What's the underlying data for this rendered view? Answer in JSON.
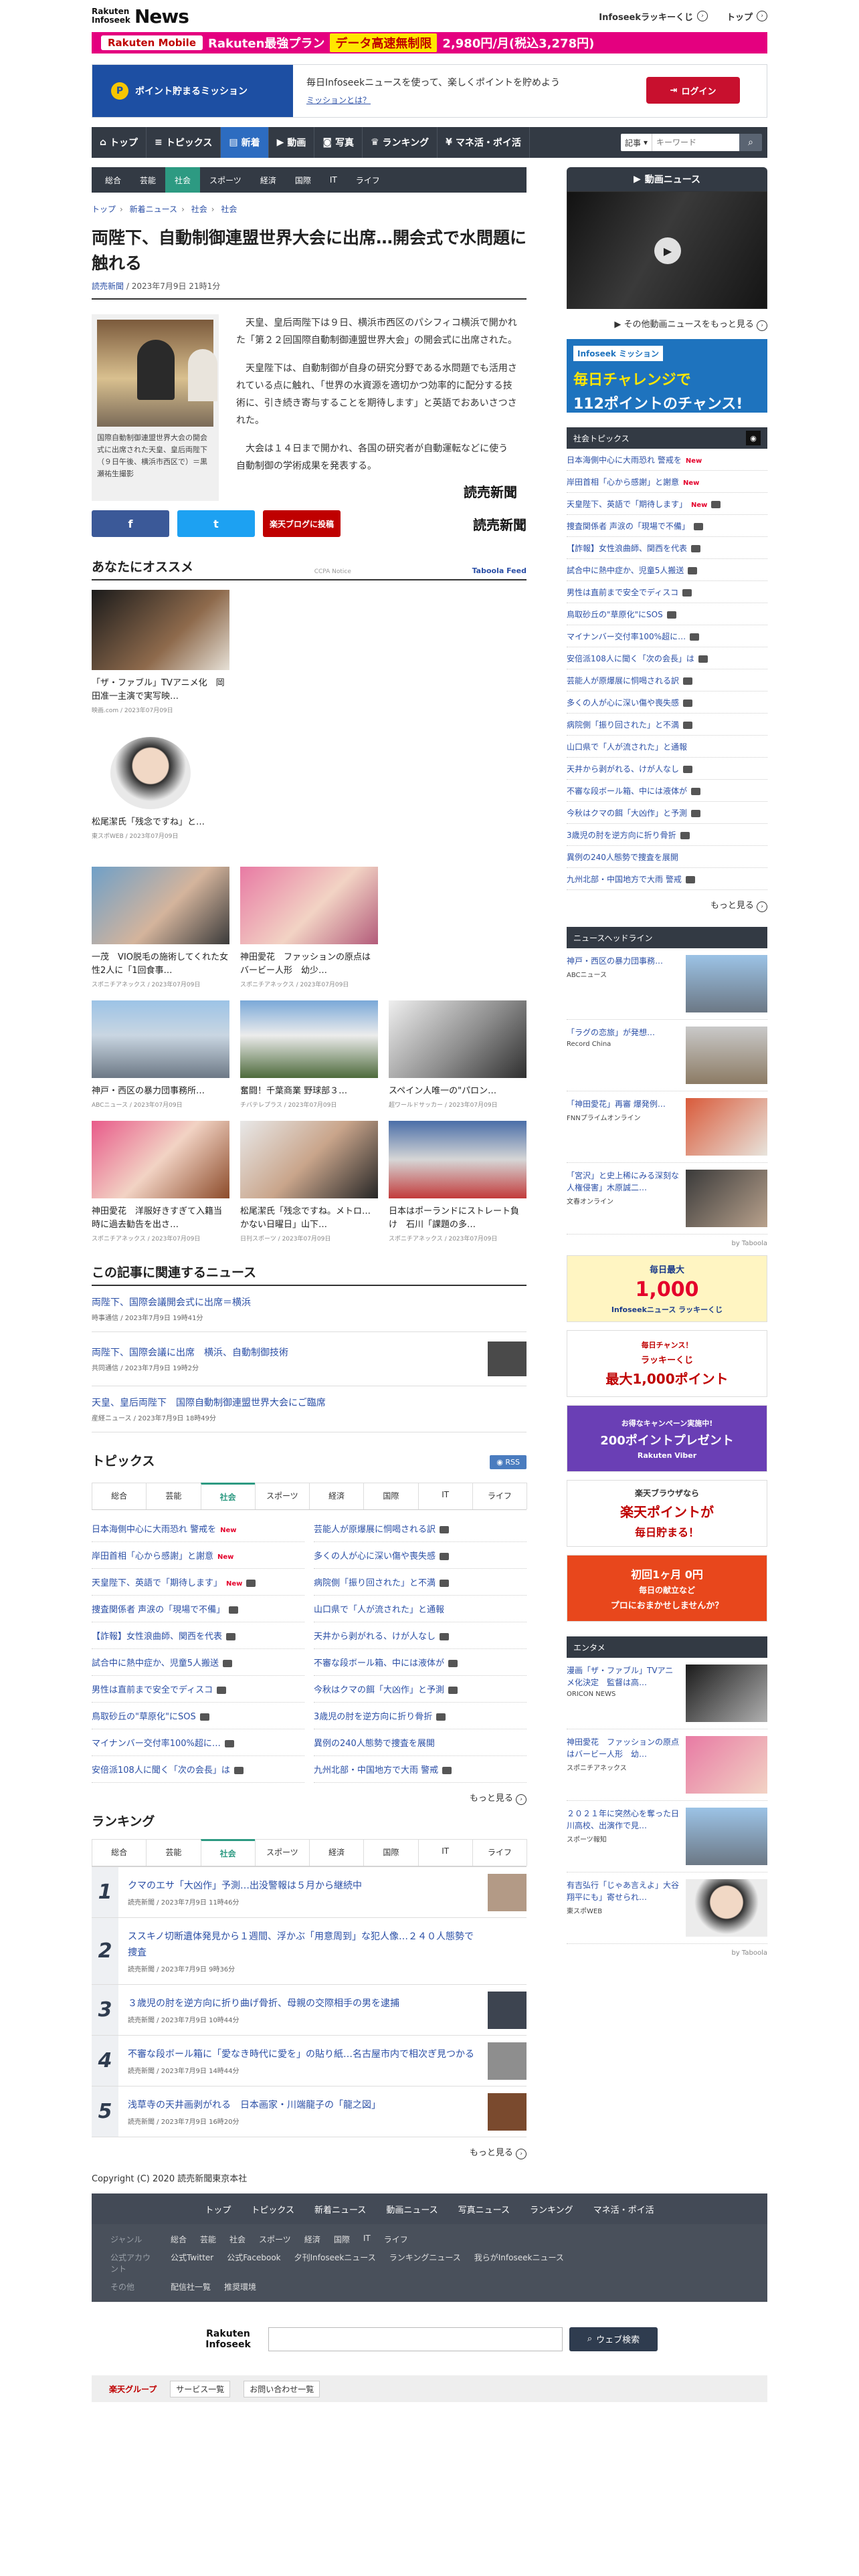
{
  "header": {
    "logo_top": "Rakuten Infoseek",
    "logo_main": "News",
    "links": [
      "Infoseekラッキーくじ",
      "トップ"
    ],
    "banner": {
      "brand": "Rakuten Mobile",
      "tagline": "Rakuten最強プラン",
      "offer": "データ高速無制限",
      "price": "2,980円/月(税込3,278円)"
    }
  },
  "mission": {
    "label": "ポイント貯まるミッション",
    "text": "毎日Infoseekニュースを使って、楽しくポイントを貯めよう",
    "link": "ミッションとは？",
    "login": "ログイン"
  },
  "gnav": {
    "items": [
      "トップ",
      "トピックス",
      "新着",
      "動画",
      "写真",
      "ランキング",
      "マネ活・ポイ活"
    ],
    "search_select": "記事",
    "search_placeholder": "キーワード"
  },
  "subnav": [
    "総合",
    "芸能",
    "社会",
    "スポーツ",
    "経済",
    "国際",
    "IT",
    "ライフ"
  ],
  "breadcrumb": [
    "トップ",
    "新着ニュース",
    "社会",
    "社会"
  ],
  "article": {
    "title": "両陛下、自動制御連盟世界大会に出席…開会式で水問題に触れる",
    "source": "読売新聞",
    "date": "2023年7月9日 21時1分",
    "caption": "国際自動制御連盟世界大会の開会式に出席された天皇、皇后両陛下（９日午後、横浜市西区で）＝黒瀬祐生撮影",
    "paragraphs": [
      "天皇、皇后両陛下は９日、横浜市西区のパシフィコ横浜で開かれた「第２２回国際自動制御連盟世界大会」の開会式に出席された。",
      "天皇陛下は、自動制御が自身の研究分野である水問題でも活用されている点に触れ、「世界の水資源を適切かつ効率的に配分する技術に、引き続き寄与することを期待します」と英語でおあいさつされた。",
      "大会は１４日まで開かれ、各国の研究者が自動運転などに使う自動制御の学術成果を発表する。"
    ],
    "publisher": "読売新聞",
    "share": [
      "f",
      "t",
      "楽天ブログに投稿"
    ]
  },
  "recommend": {
    "title": "あなたにオススメ",
    "tag": "CCPA Notice",
    "feed": "Taboola Feed",
    "items": [
      {
        "title": "「ザ・ファブル」TVアニメ化　岡田准一主演で実写映…",
        "meta": "映画.com / 2023年07月09日"
      },
      {
        "title": "松尾潔氏「残念ですね」と…",
        "meta": "東スポWEB / 2023年07月09日"
      },
      {
        "title": "一茂　VIO脱毛の施術してくれた女性2人に「1回食事…",
        "meta": "スポニチアネックス / 2023年07月09日"
      },
      {
        "title": "神田愛花　ファッションの原点はバービー人形　幼少…",
        "meta": "スポニチアネックス / 2023年07月09日"
      },
      {
        "title": "神戸・西区の暴力団事務所…",
        "meta": "ABCニュース / 2023年07月09日"
      },
      {
        "title": "奮闘！千葉商業 野球部３…",
        "meta": "チバテレプラス / 2023年07月09日"
      },
      {
        "title": "スペイン人唯一の\"パロン…",
        "meta": "超ワールドサッカー / 2023年07月09日"
      },
      {
        "title": "神田愛花　洋服好きすぎて入籍当時に過去勧告を出さ…",
        "meta": "スポニチアネックス / 2023年07月09日"
      },
      {
        "title": "松尾潔氏「残念ですね。メトロ…かない日曜日」山下…",
        "meta": "日刊スポーツ / 2023年07月09日"
      },
      {
        "title": "日本はポーランドにストレート負け　石川「課題の多…",
        "meta": "スポニチアネックス / 2023年07月09日"
      }
    ]
  },
  "related": {
    "title": "この記事に関連するニュース",
    "items": [
      {
        "title": "両陛下、国際会議開会式に出席＝横浜",
        "meta": "時事通信 / 2023年7月9日 19時41分"
      },
      {
        "title": "両陛下、国際会議に出席　横浜、自動制御技術",
        "meta": "共同通信 / 2023年7月9日 19時2分"
      },
      {
        "title": "天皇、皇后両陛下　国際自動制御連盟世界大会にご臨席",
        "meta": "産経ニュース / 2023年7月9日 18時49分"
      }
    ]
  },
  "topics": {
    "title": "トピックス",
    "rss": "RSS",
    "tabs": [
      "総合",
      "芸能",
      "社会",
      "スポーツ",
      "経済",
      "国際",
      "IT",
      "ライフ"
    ],
    "items": [
      "日本海側中心に大雨恐れ 警戒を",
      "芸能人が原爆展に恫喝される訳",
      "岸田首相「心から感謝」と謝意",
      "多くの人が心に深い傷や喪失感",
      "天皇陛下、英語で「期待します」",
      "病院側「振り回された」と不満",
      "捜査関係者 声涙の「現場で不備」",
      "山口県で「人が流された」と通報",
      "【詐報】女性浪曲師、関西を代表",
      "天井から剥がれる、けが人なし",
      "試合中に熱中症か、児童5人搬送",
      "不審な段ボール箱、中には液体が",
      "男性は直前まで安全でディスコ",
      "今秋はクマの餌「大凶作」と予測",
      "鳥取砂丘の\"草原化\"にSOS",
      "3歳児の肘を逆方向に折り骨折",
      "マイナンバー交付率100%超に…",
      "異例の240人態勢で捜査を展開",
      "安倍派108人に聞く「次の会長」は",
      "九州北部・中国地方で大雨 警戒"
    ],
    "more": "もっと見る"
  },
  "ranking": {
    "title": "ランキング",
    "tabs": [
      "総合",
      "芸能",
      "社会",
      "スポーツ",
      "経済",
      "国際",
      "IT",
      "ライフ"
    ],
    "items": [
      {
        "no": "1",
        "title": "クマのエサ「大凶作」予測…出没警報は５月から継続中",
        "meta": "読売新聞 / 2023年7月9日 11時46分"
      },
      {
        "no": "2",
        "title": "ススキノ切断遺体発見から１週間、浮かぶ「用意周到」な犯人像…２４０人態勢で捜査",
        "meta": "読売新聞 / 2023年7月9日 9時36分"
      },
      {
        "no": "3",
        "title": "３歳児の肘を逆方向に折り曲げ骨折、母親の交際相手の男を逮捕",
        "meta": "読売新聞 / 2023年7月9日 10時44分"
      },
      {
        "no": "4",
        "title": "不審な段ボール箱に「愛なき時代に愛を」の貼り紙…名古屋市内で相次ぎ見つかる",
        "meta": "読売新聞 / 2023年7月9日 14時44分"
      },
      {
        "no": "5",
        "title": "浅草寺の天井画剥がれる　日本画家・川端龍子の「龍之図」",
        "meta": "読売新聞 / 2023年7月9日 16時20分"
      }
    ],
    "more": "もっと見る"
  },
  "copyright": "Copyright (C) 2020 読売新聞東京本社",
  "side": {
    "video_title": "動画ニュース",
    "video_more": "その他動画ニュースをもっと見る",
    "ad_mission": {
      "a1": "Infoseek ミッション",
      "a2": "毎日チャレンジで",
      "a3": "112ポイントのチャンス!"
    },
    "social_title": "社会トピックス",
    "social_items": [
      "日本海側中心に大雨恐れ 警戒を",
      "岸田首相「心から感謝」と謝意",
      "天皇陛下、英語で「期待します」",
      "捜査関係者 声涙の「現場で不備」",
      "【詐報】女性浪曲師、関西を代表",
      "試合中に熱中症か、児童5人搬送",
      "男性は直前まで安全でディスコ",
      "鳥取砂丘の\"草原化\"にSOS",
      "マイナンバー交付率100%超に…",
      "安倍派108人に聞く「次の会長」は",
      "芸能人が原爆展に恫喝される訳",
      "多くの人が心に深い傷や喪失感",
      "病院側「振り回された」と不満",
      "山口県で「人が流された」と通報",
      "天井から剥がれる、けが人なし",
      "不審な段ボール箱、中には液体が",
      "今秋はクマの餌「大凶作」と予測",
      "3歳児の肘を逆方向に折り骨折",
      "異例の240人態勢で捜査を展開",
      "九州北部・中国地方で大雨 警戒"
    ],
    "social_more": "もっと見る",
    "headline_title": "ニュースヘッドライン",
    "headlines": [
      {
        "title": "神戸・西区の暴力団事務…",
        "meta": "ABCニュース"
      },
      {
        "title": "「ラグの恋旅」が発想…",
        "meta": "Record China"
      },
      {
        "title": "「神田愛花」再審 爆発例…",
        "meta": "FNNプライムオンライン"
      },
      {
        "title": "「宮沢」と史上稀にみる深刻な人権侵害」木原誠二…",
        "meta": "文春オンライン"
      }
    ],
    "by": "by Taboola",
    "ads": [
      {
        "l1": "毎日最大",
        "l2": "1,000",
        "l3": "Infoseekニュース ラッキーくじ"
      },
      {
        "l1": "ラッキーくじ",
        "l2": "最大1,000ポイント",
        "l3": "毎日チャンス！"
      },
      {
        "l1": "200ポイントプレゼント",
        "l2": "Rakuten Viber",
        "l3": "お得なキャンペーン実施中!"
      },
      {
        "l1": "楽天ブラウザなら",
        "l2": "楽天ポイントが",
        "l3": "毎日貯まる！"
      },
      {
        "l1": "初回1ヶ月 0円",
        "l2": "毎日の献立など",
        "l3": "プロにおまかせしませんか？"
      }
    ],
    "ent_title": "エンタメ",
    "ent": [
      {
        "title": "漫画「ザ・ファブル」TVアニメ化決定　監督は高…",
        "meta": "ORICON NEWS"
      },
      {
        "title": "神田愛花　ファッションの原点はバービー人形　幼…",
        "meta": "スポニチアネックス"
      },
      {
        "title": "２０２１年に突然心を奪った日川高校、出演作で見…",
        "meta": "スポーツ報知"
      },
      {
        "title": "有吉弘行「じゃあ言えよ」大谷翔平にも」寄せられ…",
        "meta": "東スポWEB"
      }
    ]
  },
  "footer": {
    "nav": [
      "トップ",
      "トピックス",
      "新着ニュース",
      "動画ニュース",
      "写真ニュース",
      "ランキング",
      "マネ活・ポイ活"
    ],
    "rows": [
      {
        "label": "ジャンル",
        "items": [
          "総合",
          "芸能",
          "社会",
          "スポーツ",
          "経済",
          "国際",
          "IT",
          "ライフ"
        ]
      },
      {
        "label": "公式アカウント",
        "items": [
          "公式Twitter",
          "公式Facebook",
          "夕刊Infoseekニュース",
          "ランキングニュース",
          "我らがInfoseekニュース"
        ]
      },
      {
        "label": "その他",
        "items": [
          "配信社一覧",
          "推奨環境"
        ]
      }
    ],
    "search_logo": "Rakuten Infoseek",
    "search_button": "ウェブ検索",
    "group": "楽天グループ",
    "group_links": [
      "サービス一覧",
      "お問い合わせ一覧"
    ]
  }
}
